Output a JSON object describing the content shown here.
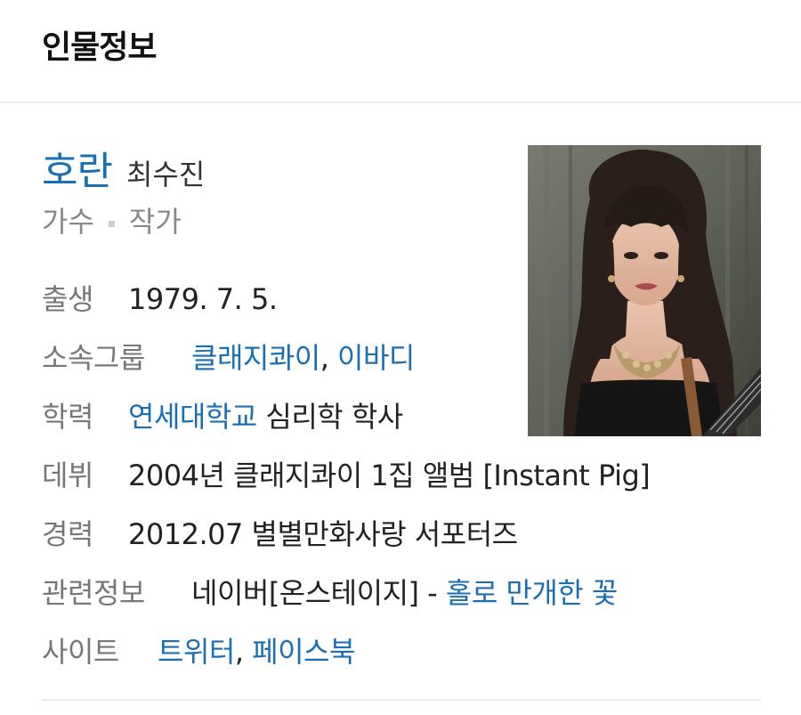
{
  "header": {
    "title": "인물정보"
  },
  "person": {
    "name": "호란",
    "real_name": "최수진",
    "jobs": [
      "가수",
      "작가"
    ]
  },
  "info": {
    "birth": {
      "label": "출생",
      "value": "1979. 7. 5."
    },
    "group": {
      "label": "소속그룹",
      "links": [
        "클래지콰이",
        "이바디"
      ],
      "sep": ", "
    },
    "education": {
      "label": "학력",
      "link": "연세대학교",
      "rest": " 심리학 학사"
    },
    "debut": {
      "label": "데뷔",
      "value": "2004년 클래지콰이 1집 앨범 [Instant Pig]"
    },
    "career": {
      "label": "경력",
      "value": "2012.07 별별만화사랑 서포터즈"
    },
    "related": {
      "label": "관련정보",
      "prefix": "네이버[온스테이지] - ",
      "link": "홀로 만개한 꽃"
    },
    "site": {
      "label": "사이트",
      "links": [
        "트위터",
        "페이스북"
      ],
      "sep": ", "
    }
  },
  "colors": {
    "link": "#1a6fb3",
    "label": "#777777",
    "text": "#222222"
  }
}
